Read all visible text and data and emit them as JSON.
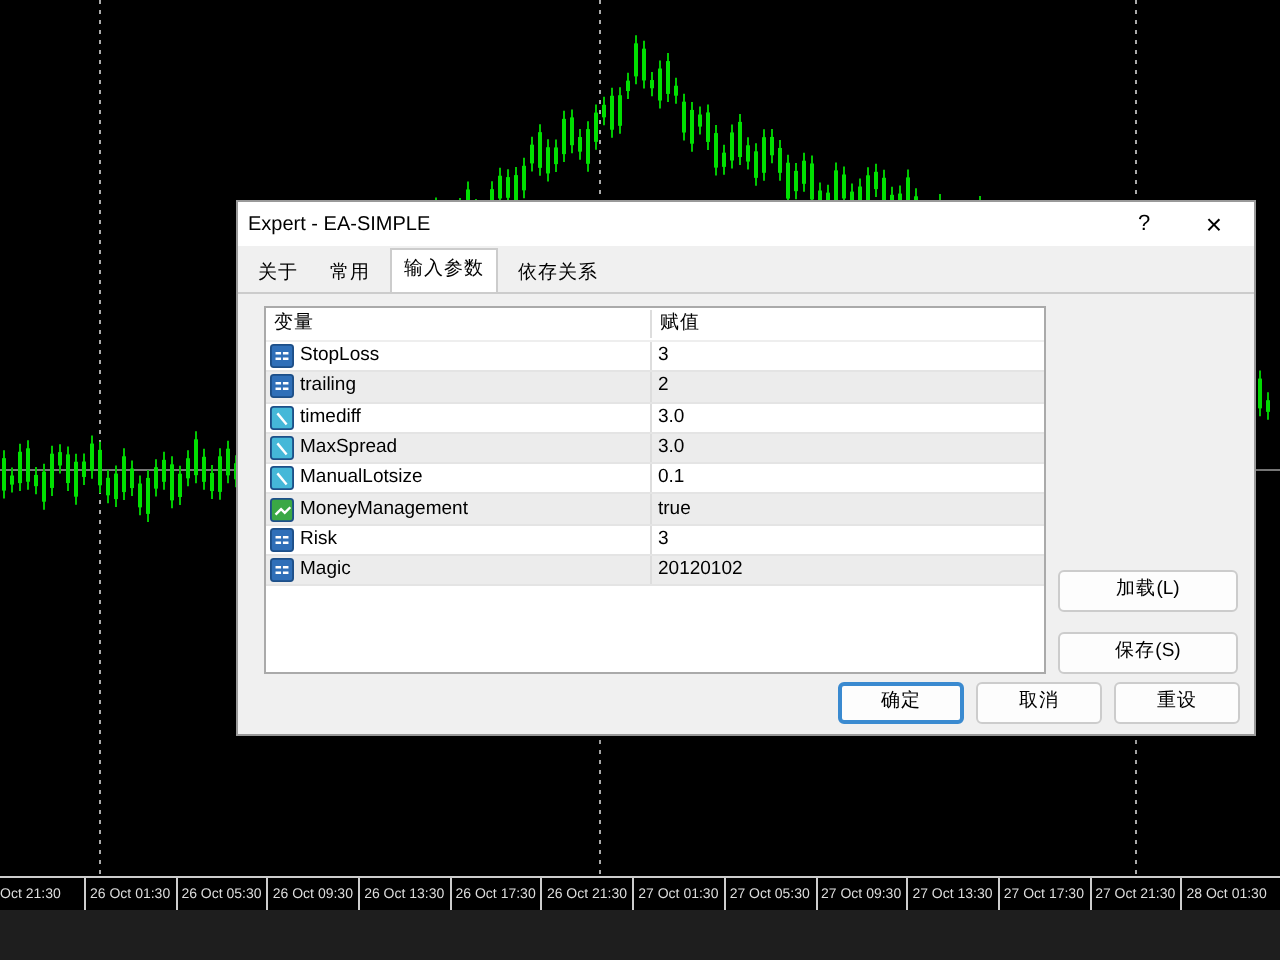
{
  "window": {
    "title": "Expert - EA-SIMPLE",
    "help": "?",
    "close": "×"
  },
  "tabs": [
    {
      "label": "关于",
      "selected": false
    },
    {
      "label": "常用",
      "selected": false
    },
    {
      "label": "输入参数",
      "selected": true
    },
    {
      "label": "依存关系",
      "selected": false
    }
  ],
  "table": {
    "columns": [
      "变量",
      "赋值"
    ],
    "rows": [
      {
        "kind": "int",
        "name": "StopLoss",
        "value": "3"
      },
      {
        "kind": "int",
        "name": "trailing",
        "value": "2"
      },
      {
        "kind": "double",
        "name": "timediff",
        "value": "3.0"
      },
      {
        "kind": "double",
        "name": "MaxSpread",
        "value": "3.0"
      },
      {
        "kind": "double",
        "name": "ManualLotsize",
        "value": "0.1"
      },
      {
        "kind": "bool",
        "name": "MoneyManagement",
        "value": "true"
      },
      {
        "kind": "int",
        "name": "Risk",
        "value": "3"
      },
      {
        "kind": "int",
        "name": "Magic",
        "value": "20120102"
      }
    ]
  },
  "side_buttons": [
    "加载(L)",
    "保存(S)"
  ],
  "buttons": [
    {
      "label": "确定",
      "default": true
    },
    {
      "label": "取消",
      "default": false
    },
    {
      "label": "重设",
      "default": false
    }
  ],
  "time_axis": [
    "Oct 21:30",
    "26 Oct 01:30",
    "26 Oct 05:30",
    "26 Oct 09:30",
    "26 Oct 13:30",
    "26 Oct 17:30",
    "26 Oct 21:30",
    "27 Oct 01:30",
    "27 Oct 05:30",
    "27 Oct 09:30",
    "27 Oct 13:30",
    "27 Oct 17:30",
    "27 Oct 21:30",
    "28 Oct 01:30"
  ]
}
